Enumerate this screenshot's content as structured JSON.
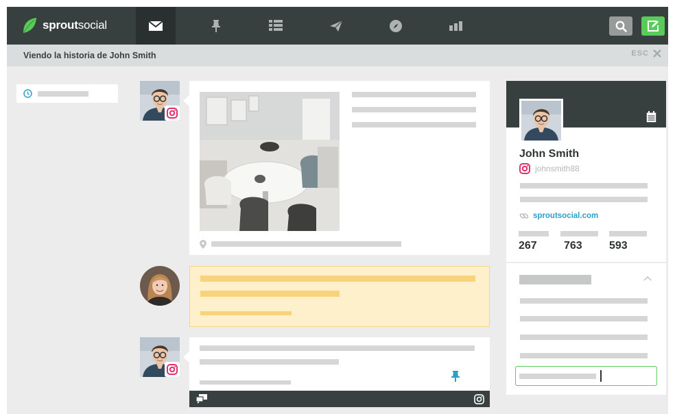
{
  "app": {
    "brand_bold": "sprout",
    "brand_light": "social",
    "brand_color": "#59cb59"
  },
  "nav": {
    "tabs": [
      {
        "icon": "envelope-icon",
        "active": true
      },
      {
        "icon": "pin-icon",
        "active": false
      },
      {
        "icon": "list-icon",
        "active": false
      },
      {
        "icon": "paper-plane-icon",
        "active": false
      },
      {
        "icon": "compass-icon",
        "active": false
      },
      {
        "icon": "bar-chart-icon",
        "active": false
      }
    ],
    "search_icon": "search-icon",
    "compose_icon": "compose-icon"
  },
  "subbar": {
    "title": "Viendo la historia de John Smith",
    "esc_label": "ESC"
  },
  "profile": {
    "name": "John Smith",
    "handle": "johnsmith88",
    "network": "instagram",
    "website": "sproutsocial.com",
    "stats": [
      "267",
      "763",
      "593"
    ]
  },
  "colors": {
    "topbar": "#38403f",
    "accent_green": "#59cb59",
    "link_blue": "#2aa1c7",
    "pin_blue": "#2aa1c7",
    "instagram": "#e1306c",
    "highlight_yellow": "#fdf0ca"
  }
}
